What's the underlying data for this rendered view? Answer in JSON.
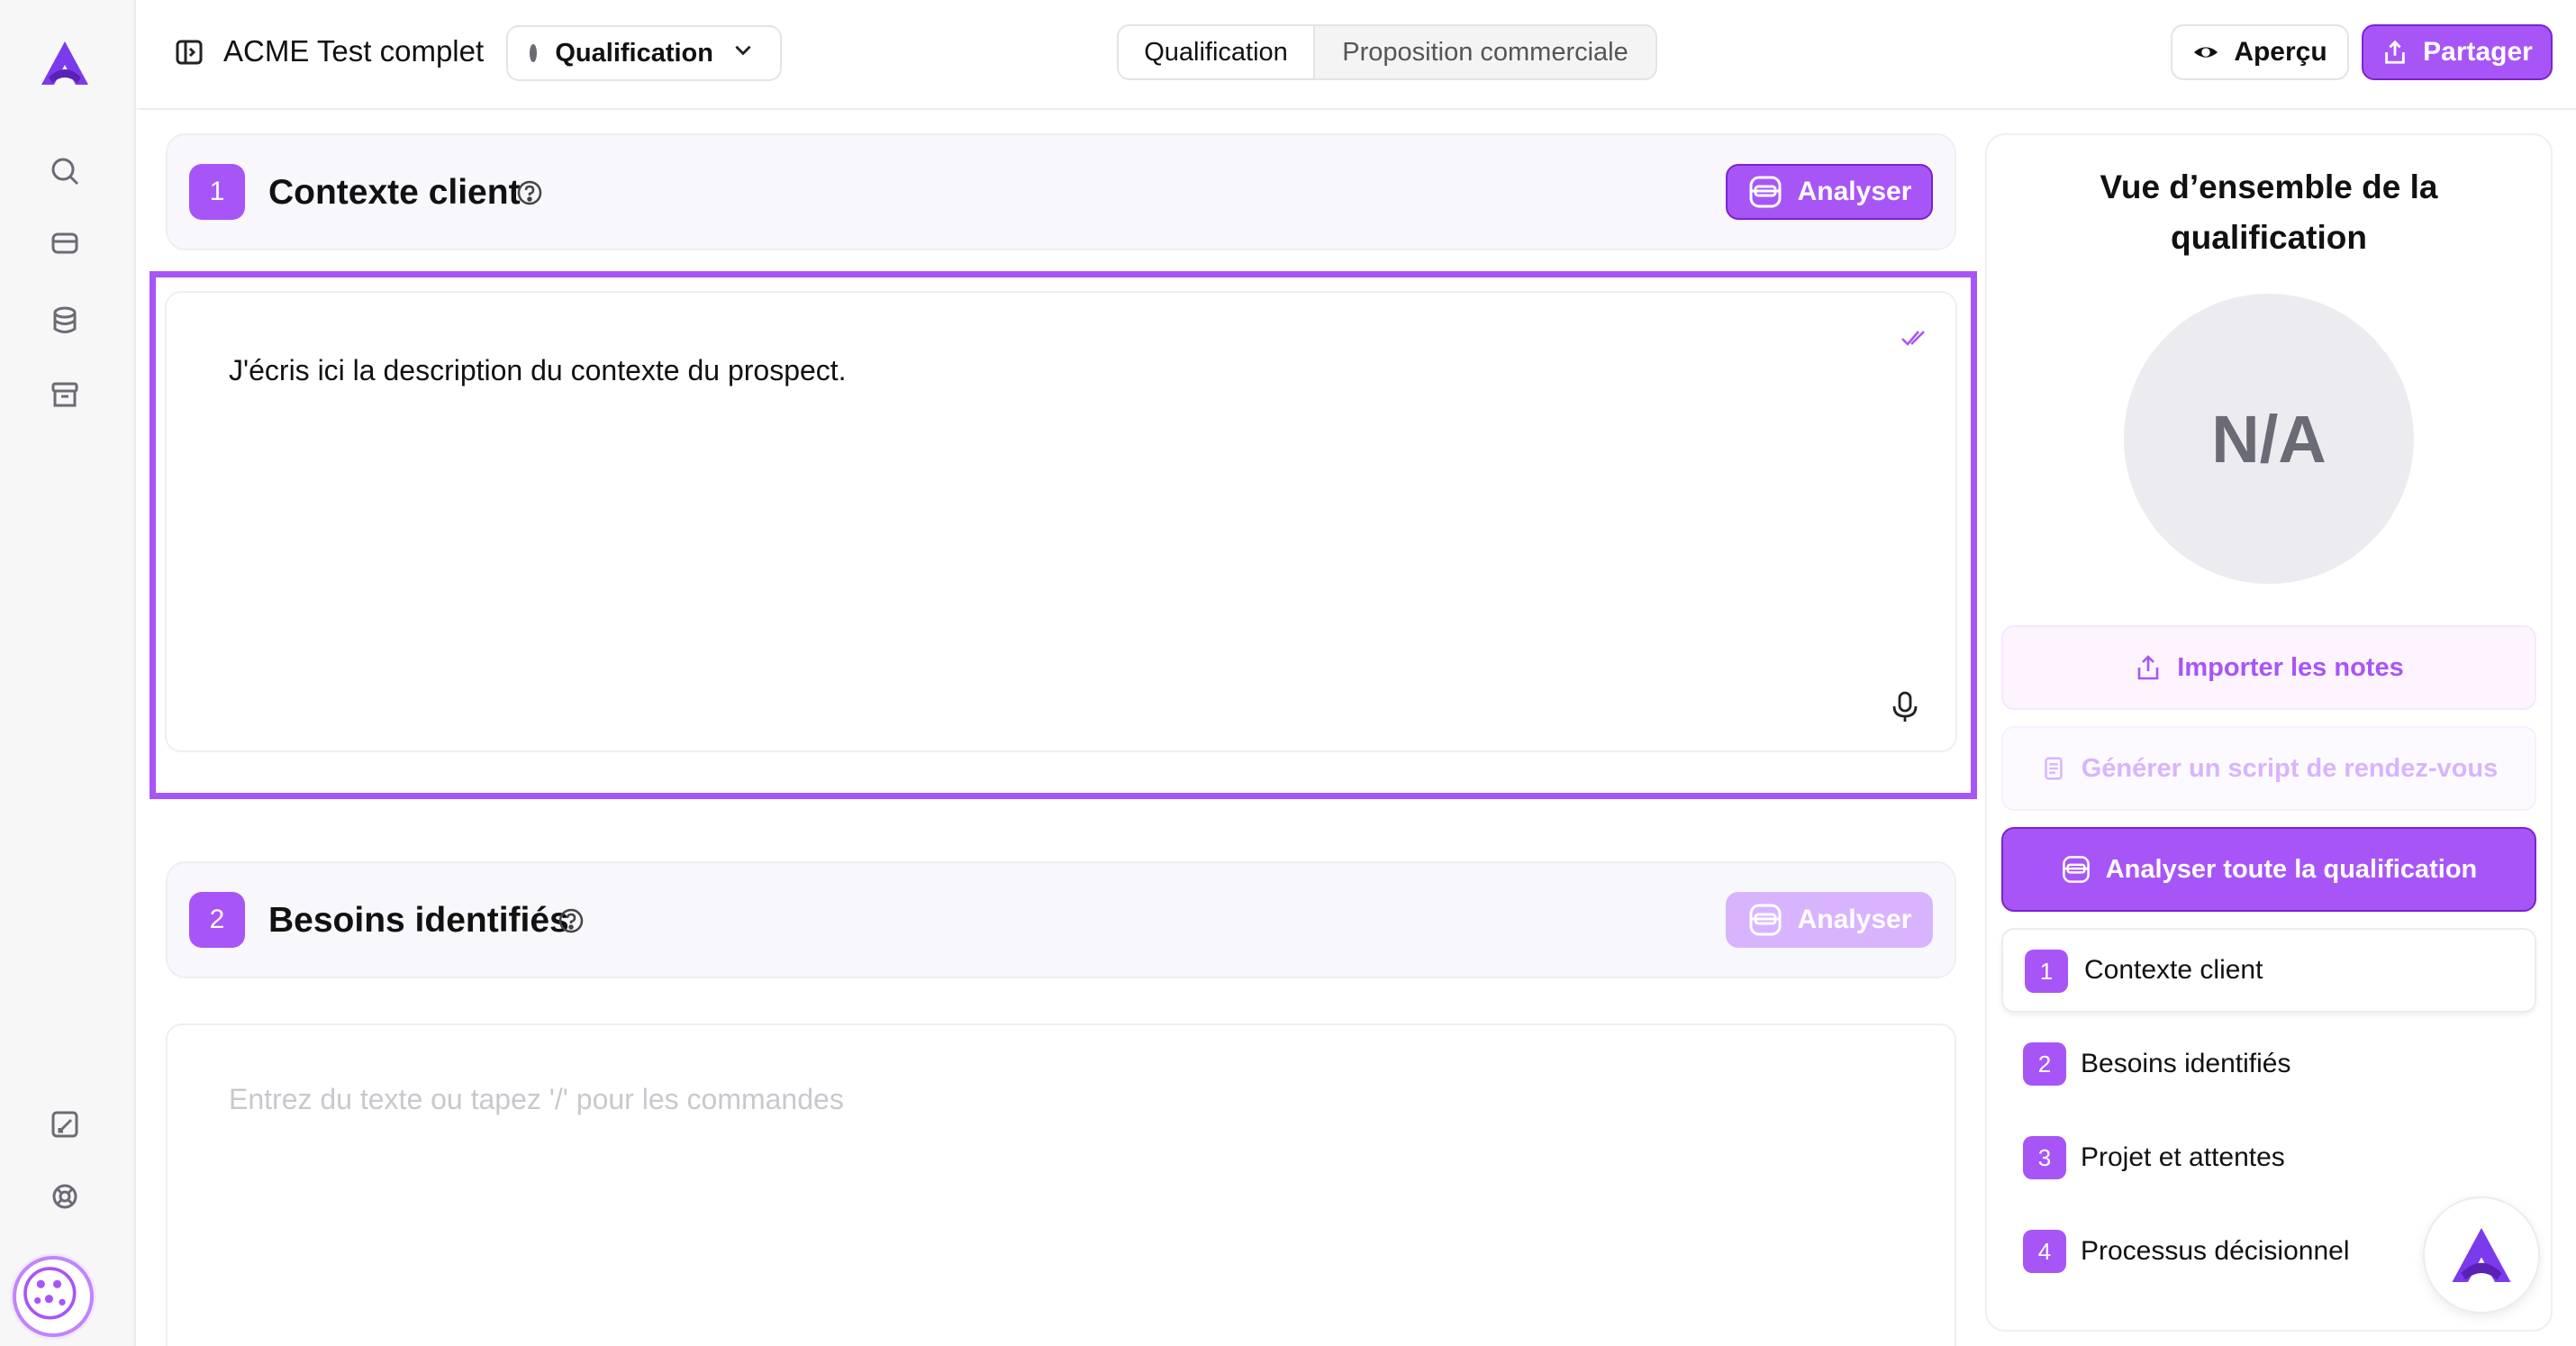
{
  "header": {
    "doc_title": "ACME Test complet",
    "status_label": "Qualification",
    "tabs": [
      {
        "label": "Qualification",
        "active": true
      },
      {
        "label": "Proposition commerciale",
        "active": false
      }
    ],
    "preview_label": "Aperçu",
    "share_label": "Partager"
  },
  "sections": [
    {
      "number": "1",
      "title": "Contexte client",
      "analyze_label": "Analyser",
      "content": "J'écris ici la description du contexte du prospect."
    },
    {
      "number": "2",
      "title": "Besoins identifiés",
      "analyze_label": "Analyser",
      "placeholder": "Entrez du texte ou tapez '/' pour les commandes"
    }
  ],
  "overview": {
    "title_line1": "Vue d’ensemble de la",
    "title_line2": "qualification",
    "score": "N/A",
    "import_label": "Importer les notes",
    "script_label": "Générer un script de rendez-vous",
    "analyze_all_label": "Analyser toute la qualification",
    "steps": [
      {
        "number": "1",
        "label": "Contexte client"
      },
      {
        "number": "2",
        "label": "Besoins identifiés"
      },
      {
        "number": "3",
        "label": "Projet et attentes"
      },
      {
        "number": "4",
        "label": "Processus décisionnel"
      }
    ]
  },
  "colors": {
    "accent": "#a855f7",
    "accent_dark": "#7e22ce",
    "accent_light": "#d8b4fe",
    "logo": "#7c3aed"
  }
}
